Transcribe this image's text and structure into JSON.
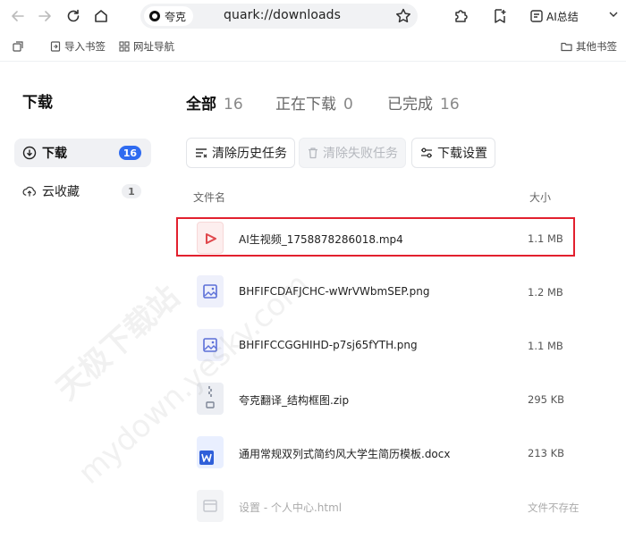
{
  "browser": {
    "site_chip": "夸克",
    "url": "quark://downloads",
    "ai_summary": "AI总结"
  },
  "bookmarks": {
    "import": "导入书签",
    "nav": "网址导航",
    "other": "其他书签"
  },
  "sidebar": {
    "title": "下载",
    "items": [
      {
        "label": "下载",
        "badge": "16"
      },
      {
        "label": "云收藏",
        "badge": "1"
      }
    ]
  },
  "tabs": [
    {
      "label": "全部",
      "count": "16"
    },
    {
      "label": "正在下载",
      "count": "0"
    },
    {
      "label": "已完成",
      "count": "16"
    }
  ],
  "actions": {
    "clear_history": "清除历史任务",
    "clear_failed": "清除失败任务",
    "settings": "下载设置"
  },
  "table": {
    "col_name": "文件名",
    "col_size": "大小",
    "rows": [
      {
        "name": "AI生视频_1758878286018.mp4",
        "size": "1.1 MB",
        "icon": "video-file-icon"
      },
      {
        "name": "BHFIFCDAFJCHC-wWrVWbmSEP.png",
        "size": "1.2 MB",
        "icon": "image-file-icon"
      },
      {
        "name": "BHFIFCCGGHIHD-p7sj65fYTH.png",
        "size": "1.1 MB",
        "icon": "image-file-icon"
      },
      {
        "name": "夸克翻译_结构框图.zip",
        "size": "295 KB",
        "icon": "zip-file-icon"
      },
      {
        "name": "通用常规双列式简约风大学生简历模板.docx",
        "size": "213 KB",
        "icon": "word-file-icon"
      },
      {
        "name": "设置 - 个人中心.html",
        "size": "文件不存在",
        "icon": "html-file-icon"
      }
    ]
  },
  "watermark": {
    "line1": "天极下载站",
    "line2": "mydown.yesky.com"
  },
  "colors": {
    "accent": "#2f6bf0",
    "highlight": "#e2202e"
  }
}
